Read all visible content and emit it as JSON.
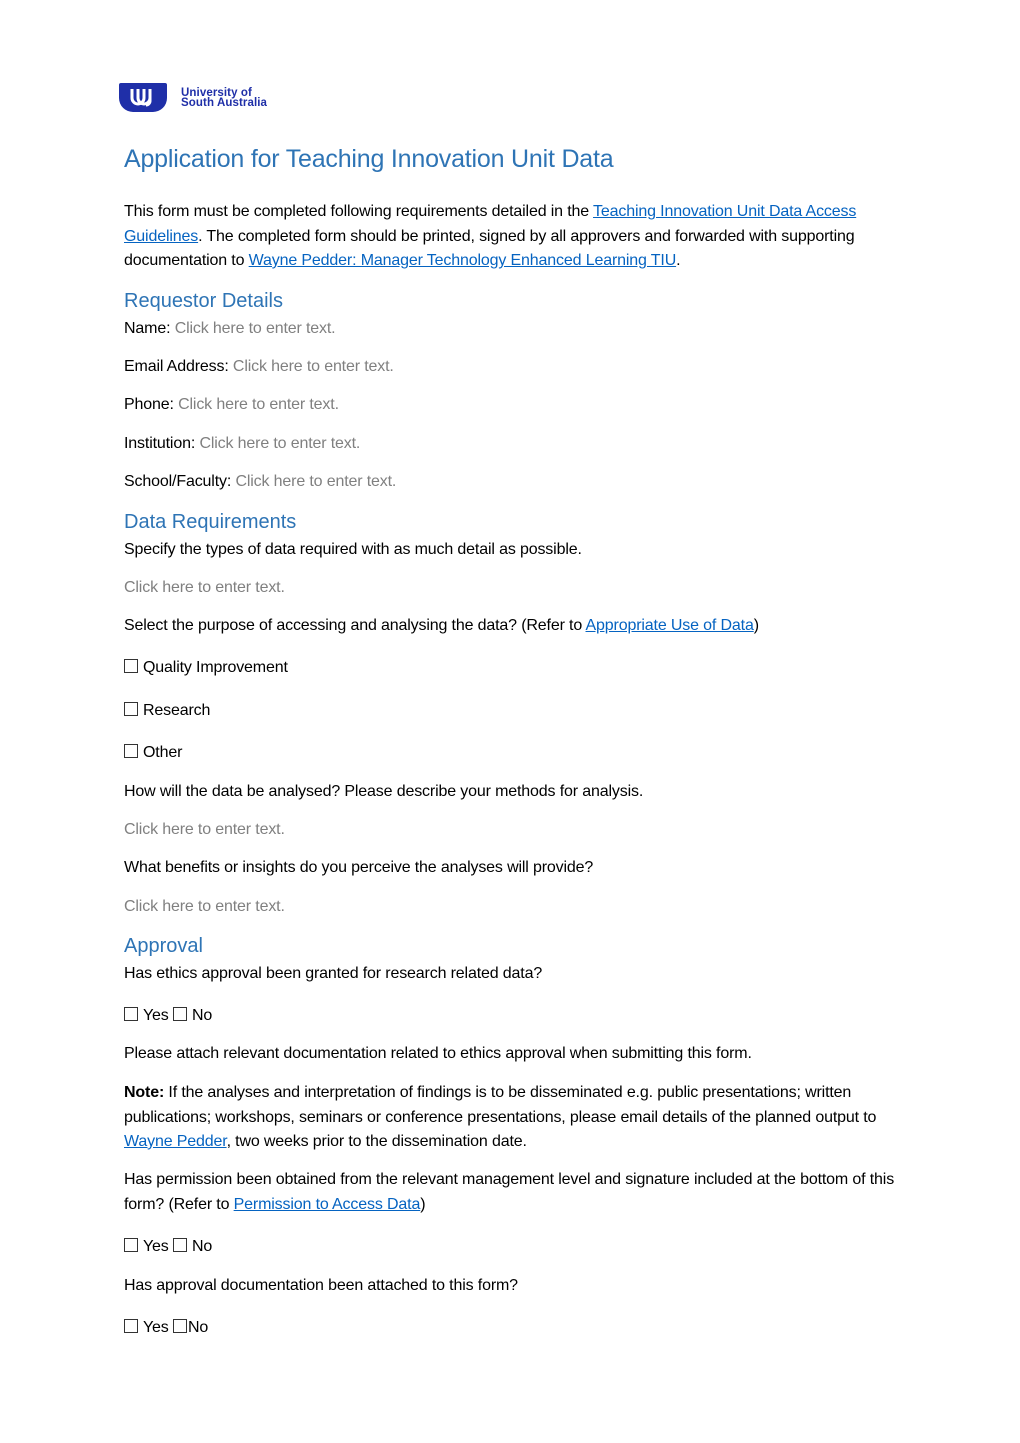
{
  "logo": {
    "line1": "University of",
    "line2": "South Australia",
    "brand_color": "#1f2fa8"
  },
  "title": "Application for Teaching Innovation Unit Data",
  "intro": {
    "text1": "This form must be completed following requirements detailed in the ",
    "link1": "Teaching Innovation Unit Data Access Guidelines",
    "text2": ". The completed form should be printed, signed by all approvers and forwarded with supporting documentation to ",
    "link2": "Wayne Pedder: Manager Technology Enhanced Learning TIU",
    "text3": "."
  },
  "requestor": {
    "heading": "Requestor Details",
    "fields": [
      {
        "label": "Name:",
        "placeholder": "Click here to enter text."
      },
      {
        "label": "Email Address:",
        "placeholder": "Click here to enter text."
      },
      {
        "label": "Phone:",
        "placeholder": "Click here to enter text."
      },
      {
        "label": "Institution:",
        "placeholder": "Click here to enter text."
      },
      {
        "label": "School/Faculty:",
        "placeholder": "Click here to enter text."
      }
    ]
  },
  "data_requirements": {
    "heading": "Data Requirements",
    "specify": "Specify the types of data required with as much detail as possible.",
    "specify_placeholder": "Click here to enter text.",
    "purpose_text": "Select the purpose of accessing and analysing the data? (Refer to ",
    "purpose_link": "Appropriate Use of Data",
    "purpose_close": ")",
    "purposes": [
      {
        "label": "Quality Improvement",
        "checked": false
      },
      {
        "label": "Research",
        "checked": false
      },
      {
        "label": "Other",
        "checked": false
      }
    ],
    "analysis_q": "How will the data be analysed? Please describe your methods for analysis.",
    "analysis_placeholder": "Click here to enter text.",
    "benefits_q": "What benefits or insights do you perceive the analyses will provide?",
    "benefits_placeholder": "Click here to enter text."
  },
  "approval": {
    "heading": "Approval",
    "ethics_q": "Has ethics approval been granted for research related data?",
    "yes": "Yes",
    "no": "No",
    "attach_note": "Please attach relevant documentation related to ethics approval when submitting this form.",
    "note_label": "Note:",
    "note_text1": " If the analyses and interpretation of findings is to be disseminated e.g. public presentations; written publications; workshops, seminars or conference presentations, please email details of the planned output to ",
    "note_link": "Wayne Pedder",
    "note_text2": ", two weeks prior to the dissemination date.",
    "permission_q": "Has permission been obtained from the relevant management level and signature included at the bottom of this form? (Refer to ",
    "permission_link": "Permission to Access Data",
    "permission_close": ")",
    "attached_q": "Has approval documentation been attached to this form?"
  },
  "colors": {
    "heading": "#2e74b5",
    "link": "#0563c1",
    "placeholder": "#808080"
  }
}
